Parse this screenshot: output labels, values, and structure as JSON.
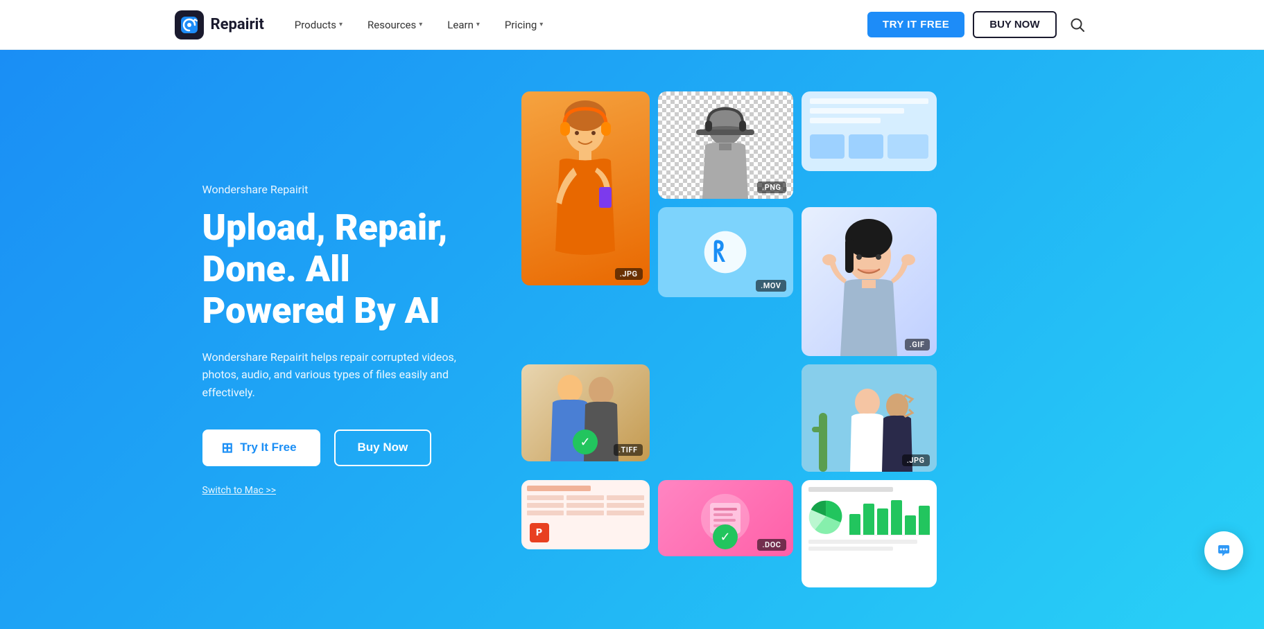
{
  "navbar": {
    "logo_text": "Repairit",
    "nav_items": [
      {
        "label": "Products",
        "has_dropdown": true
      },
      {
        "label": "Resources",
        "has_dropdown": true
      },
      {
        "label": "Learn",
        "has_dropdown": true
      },
      {
        "label": "Pricing",
        "has_dropdown": true
      }
    ],
    "btn_try_label": "TRY IT FREE",
    "btn_buy_label": "BUY NOW"
  },
  "hero": {
    "subtitle": "Wondershare Repairit",
    "title": "Upload, Repair, Done. All Powered By AI",
    "description": "Wondershare Repairit helps repair corrupted videos, photos, audio, and various types of files easily and effectively.",
    "btn_try_label": "Try It Free",
    "btn_buy_label": "Buy Now",
    "switch_mac_label": "Switch to Mac >>",
    "cards": [
      {
        "label": ".JPG",
        "id": "card-orange-girl"
      },
      {
        "label": ".PNG",
        "id": "card-grayscale"
      },
      {
        "label": "",
        "id": "card-blue-doc-top"
      },
      {
        "label": ".MOV",
        "id": "card-spinner"
      },
      {
        "label": ".GIF",
        "id": "card-asian-woman"
      },
      {
        "label": ".TIFF",
        "id": "card-two-people",
        "has_check": true
      },
      {
        "label": "",
        "id": "card-spreadsheet-pink"
      },
      {
        "label": ".DOC",
        "id": "card-woman-working",
        "has_check": true
      },
      {
        "label": ".JPG",
        "id": "card-friends-photo"
      },
      {
        "label": "",
        "id": "card-chart-doc"
      }
    ]
  },
  "chat_widget": {
    "icon": "chat-bubble-icon"
  }
}
